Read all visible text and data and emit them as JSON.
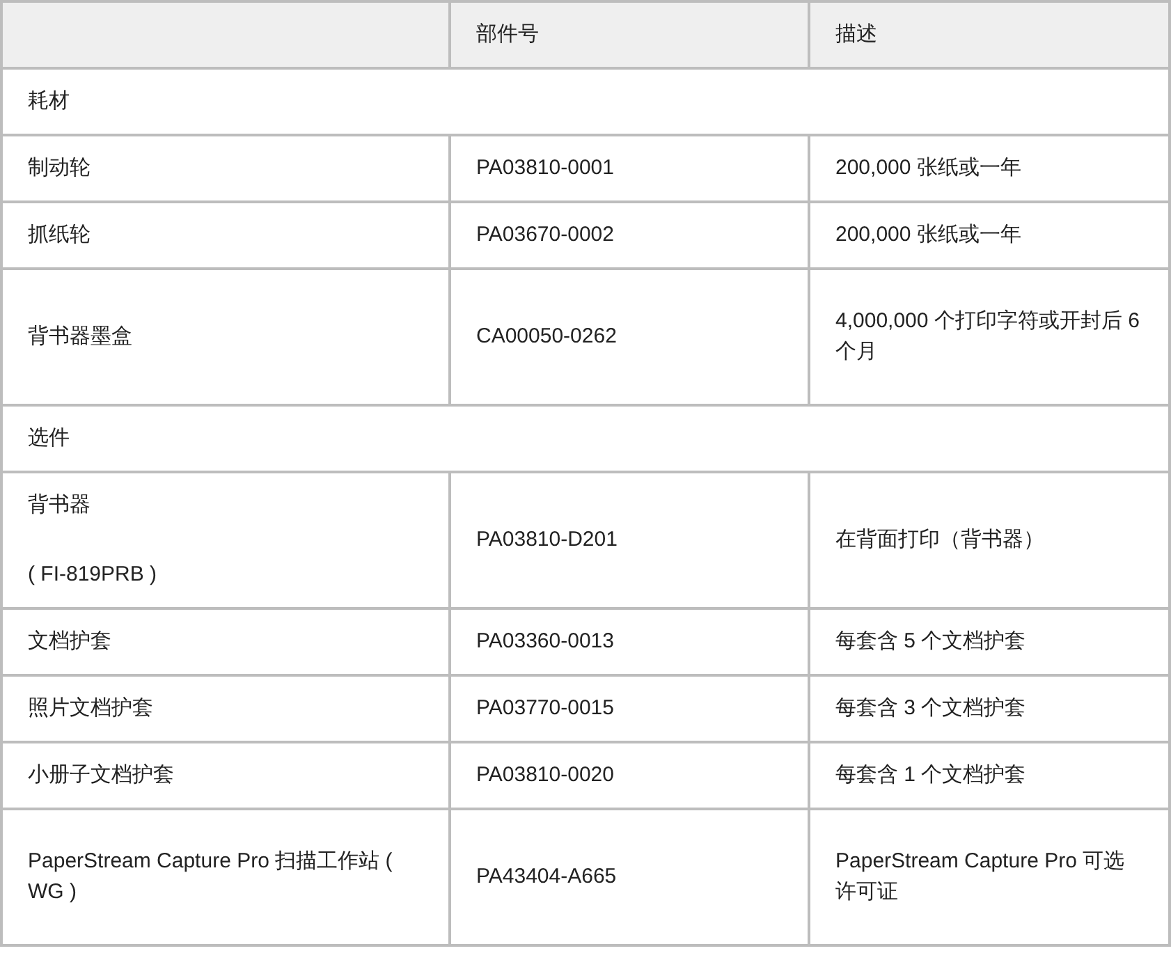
{
  "table": {
    "columns": [
      "部件号",
      "描述"
    ],
    "rows": [
      {
        "kind": "section",
        "label": "耗材"
      },
      {
        "kind": "item",
        "name": [
          "制动轮"
        ],
        "part": "PA03810-0001",
        "description": "200,000 张纸或一年"
      },
      {
        "kind": "item",
        "name": [
          "抓纸轮"
        ],
        "part": "PA03670-0002",
        "description": "200,000 张纸或一年"
      },
      {
        "kind": "item",
        "name": [
          "背书器墨盒"
        ],
        "part": "CA00050-0262",
        "description": "4,000,000 个打印字符或开封后 6 个月"
      },
      {
        "kind": "section",
        "label": "选件"
      },
      {
        "kind": "item",
        "name": [
          "背书器",
          "( FI-819PRB )"
        ],
        "part": "PA03810-D201",
        "description": "在背面打印（背书器）"
      },
      {
        "kind": "item",
        "name": [
          "文档护套"
        ],
        "part": "PA03360-0013",
        "description": "每套含 5 个文档护套"
      },
      {
        "kind": "item",
        "name": [
          "照片文档护套"
        ],
        "part": "PA03770-0015",
        "description": "每套含 3 个文档护套"
      },
      {
        "kind": "item",
        "name": [
          "小册子文档护套"
        ],
        "part": "PA03810-0020",
        "description": "每套含 1 个文档护套"
      },
      {
        "kind": "item",
        "name": [
          "PaperStream Capture Pro 扫描工作站 ( WG )"
        ],
        "part": "PA43404-A665",
        "description": "PaperStream Capture Pro 可选许可证"
      }
    ]
  }
}
